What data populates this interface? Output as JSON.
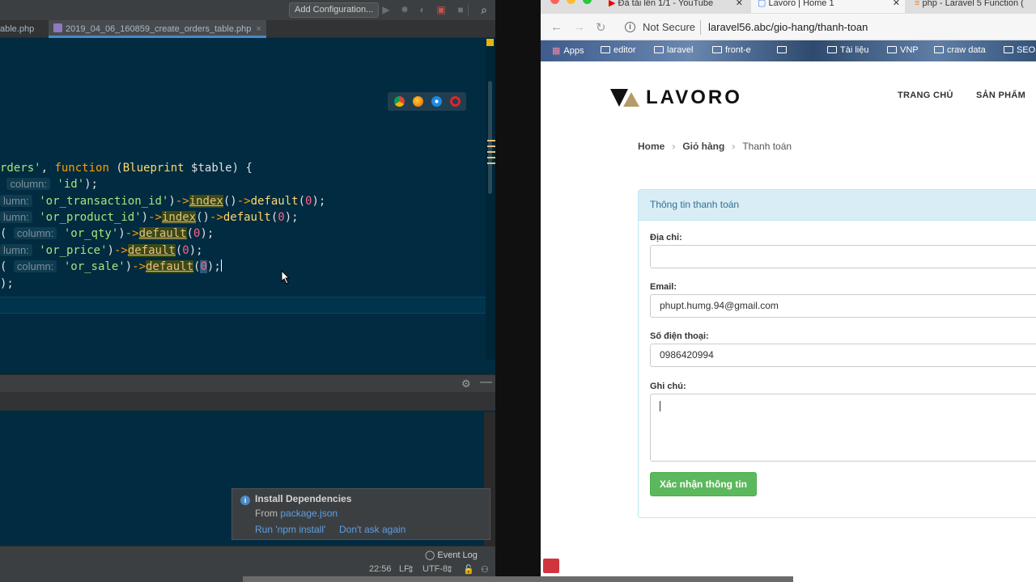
{
  "ide": {
    "toolbar": {
      "add_config": "Add Configuration..."
    },
    "tabs": [
      "able.php",
      "2019_04_06_160859_create_orders_table.php"
    ],
    "tab_close": "×",
    "code": {
      "line1": {
        "a": "rders'",
        "b": ", ",
        "kw": "function",
        "c": " (",
        "cls": "Blueprint",
        "d": " ",
        "var": "$table",
        "e": ") {"
      },
      "line2": {
        "hint": "column:",
        "s": "'id'",
        "e": ");"
      },
      "line3": {
        "hint": "lumn:",
        "s": "'or_transaction_id'",
        "e1": ")",
        "arr1": "->",
        "fn": "index",
        "e2": "()",
        "arr2": "->",
        "d": "default",
        "e3": "(",
        "num": "0",
        "e4": ");"
      },
      "line4": {
        "hint": "lumn:",
        "s": "'or_product_id'",
        "e1": ")",
        "arr1": "->",
        "fn": "index",
        "e2": "()",
        "arr2": "->",
        "d": "default",
        "e3": "(",
        "num": "0",
        "e4": ");"
      },
      "line5": {
        "pre": "(",
        "hint": "column:",
        "s": "'or_qty'",
        "e1": ")",
        "arr1": "->",
        "fn": "default",
        "e3": "(",
        "num": "0",
        "e4": ");"
      },
      "line6": {
        "hint": "lumn:",
        "s": "'or_price'",
        "e1": ")",
        "arr1": "->",
        "fn": "default",
        "e3": "(",
        "num": "0",
        "e4": ");"
      },
      "line7": {
        "pre": "(",
        "hint": "column:",
        "s": "'or_sale'",
        "e1": ")",
        "arr1": "->",
        "fn": "default",
        "e3": "(",
        "num": "0",
        "e4": ");"
      },
      "line8": {
        "e": ");"
      }
    },
    "notification": {
      "title": "Install Dependencies",
      "from_label": "From",
      "from_file": "package.json",
      "action_run": "Run 'npm install'",
      "action_dismiss": "Don't ask again"
    },
    "status": {
      "event_log": "Event Log",
      "position": "22:56",
      "line_sep": "LF",
      "encoding": "UTF-8"
    }
  },
  "browser": {
    "tabs": [
      "Đã tải lên 1/1 - YouTube",
      "Lavoro | Home 1",
      "php - Laravel 5 Function ("
    ],
    "address": {
      "security": "Not Secure",
      "url": "laravel56.abc/gio-hang/thanh-toan"
    },
    "bookmarks": [
      "Apps",
      "editor",
      "laravel",
      "front-e",
      "",
      "Tài liệu",
      "VNP",
      "craw data",
      "SEO"
    ],
    "site": {
      "logo": "LAVORO",
      "nav": [
        "TRANG CHỦ",
        "SẢN PHẨM"
      ],
      "breadcrumb": {
        "home": "Home",
        "cart": "Giỏ hàng",
        "current": "Thanh toán"
      },
      "form": {
        "panel_title": "Thông tin thanh toán",
        "address_label": "Địa chỉ:",
        "address_value": "",
        "email_label": "Email:",
        "email_value": "phupt.humg.94@gmail.com",
        "phone_label": "Số điện thoại:",
        "phone_value": "0986420994",
        "note_label": "Ghi chú:",
        "note_value": "",
        "submit": "Xác nhận thông tin"
      }
    }
  },
  "colors": {
    "editor_bg": "#002b40",
    "string": "#a8e37c",
    "keyword": "#ff9d00",
    "number": "#ff628c",
    "panel_head": "#d9edf7",
    "submit_btn": "#5cb85c"
  }
}
